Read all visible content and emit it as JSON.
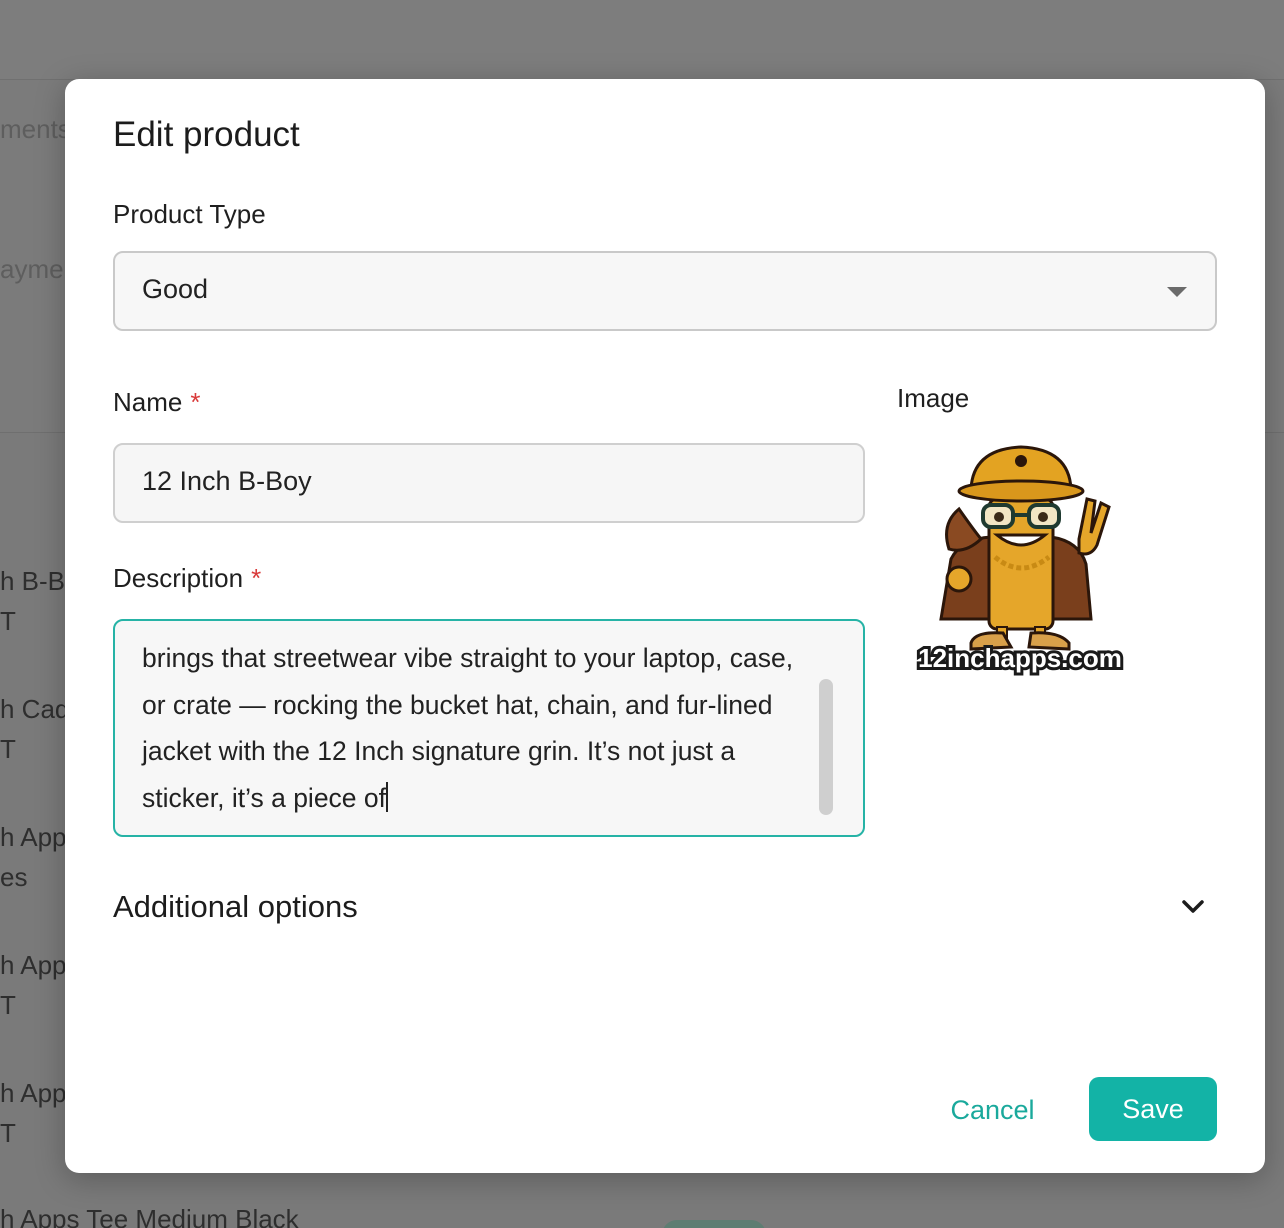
{
  "background": {
    "fragments": [
      "ments",
      "ayme",
      "h B-Bo",
      "T",
      "h Cad",
      "T",
      "h App",
      "es",
      "h App",
      "T",
      "h App",
      "T",
      "h Apps Tee Medium Black"
    ]
  },
  "modal": {
    "title": "Edit product",
    "product_type": {
      "label": "Product Type",
      "value": "Good",
      "icon": "caret-down-icon"
    },
    "name": {
      "label": "Name",
      "required_mark": "*",
      "value": "12 Inch B-Boy"
    },
    "description": {
      "label": "Description",
      "required_mark": "*",
      "value": "brings that streetwear vibe straight to your laptop, case, or crate — rocking the bucket hat, chain, and fur-lined jacket with the 12 Inch signature grin. It’s not just a sticker, it’s a piece of"
    },
    "image": {
      "label": "Image",
      "logo_text": "12inchapps.com"
    },
    "additional_options": {
      "label": "Additional options",
      "icon": "chevron-down-icon"
    },
    "actions": {
      "cancel_label": "Cancel",
      "save_label": "Save"
    }
  },
  "colors": {
    "accent": "#13b3a6",
    "required": "#d93a3a",
    "overlay": "#7a7a7a"
  }
}
